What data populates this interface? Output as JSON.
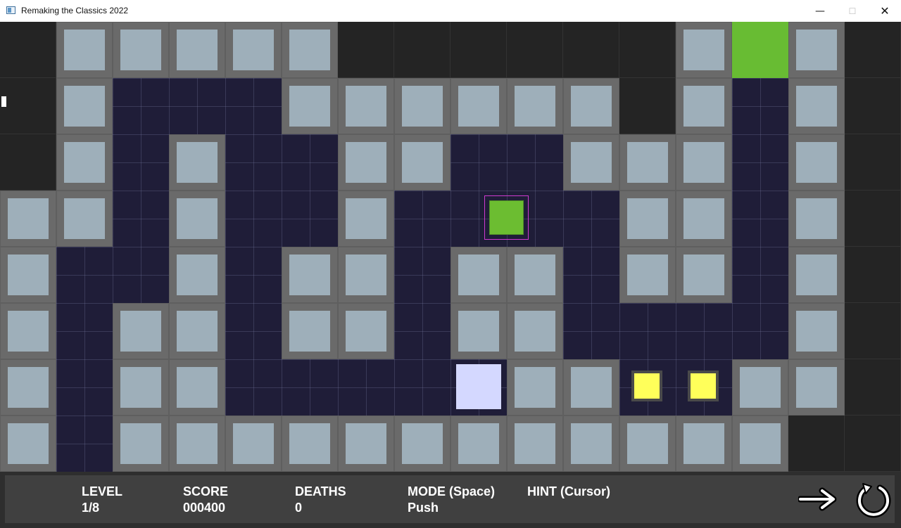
{
  "window": {
    "title": "Remaking the Classics 2022",
    "minimize_glyph": "—",
    "maximize_glyph": "☐",
    "close_glyph": "✕"
  },
  "level_map": {
    "legend": {
      "W": "wall",
      "F": "floor",
      "G": "exit",
      ".": "empty"
    },
    "rows": [
      ".WWWWW......WGW.",
      ".WFFFWWWWWW.WFW.",
      ".WFWFFWWFFWWWFW.",
      "WWFWFFWFFFFWWFW.",
      "WFFWFWWFWWFWWFW.",
      "WFWWFWWFWWFFFFW.",
      "WFWWFFFFFWWFFWW.",
      "WFWWWWWWWWWWWW.."
    ]
  },
  "entities": {
    "player": {
      "col": 8,
      "row": 3,
      "color": "#6cbd31",
      "highlight": "#cf3ad0"
    },
    "push_block": {
      "col": 8,
      "row": 6,
      "color": "#d4d8ff"
    },
    "pickups": [
      {
        "col": 11,
        "row": 6,
        "color": "#ffff5a"
      },
      {
        "col": 12,
        "row": 6,
        "color": "#ffff5a"
      }
    ]
  },
  "colors": {
    "wall_outer": "#6a6a6a",
    "wall_inner": "#9eafba",
    "floor": "#1f1d38",
    "exit": "#68bc33",
    "background": "#242424"
  },
  "hud": {
    "level": {
      "label": "LEVEL",
      "value": "1/8"
    },
    "score": {
      "label": "SCORE",
      "value": "000400"
    },
    "deaths": {
      "label": "DEATHS",
      "value": "0"
    },
    "mode": {
      "label": "MODE (Space)",
      "value": "Push"
    },
    "hint": {
      "label": "HINT (Cursor)"
    },
    "next_icon": "arrow-right-icon",
    "restart_icon": "restart-icon"
  }
}
